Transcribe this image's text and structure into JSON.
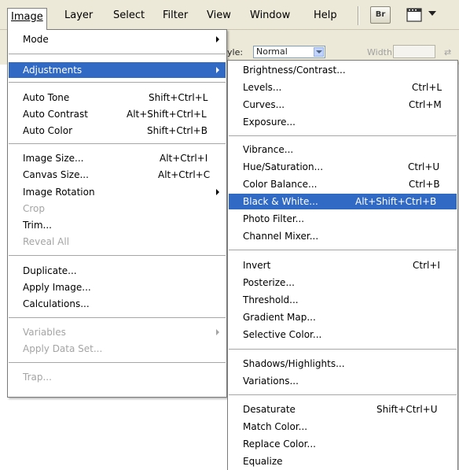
{
  "menubar": {
    "items": [
      {
        "label": "Image"
      },
      {
        "label": "Layer"
      },
      {
        "label": "Select"
      },
      {
        "label": "Filter"
      },
      {
        "label": "View"
      },
      {
        "label": "Window"
      },
      {
        "label": "Help"
      }
    ],
    "bridge_button": "Br",
    "screen_mode_icon": "screen-mode-icon"
  },
  "options_bar": {
    "style_label": "yle:",
    "style_value": "Normal",
    "width_label": "Width:"
  },
  "image_menu": {
    "items": [
      {
        "label": "Mode",
        "shortcut": "",
        "submenu": true
      },
      {
        "label": "Adjustments",
        "shortcut": "",
        "submenu": true
      },
      {
        "label": "Auto Tone",
        "shortcut": "Shift+Ctrl+L"
      },
      {
        "label": "Auto Contrast",
        "shortcut": "Alt+Shift+Ctrl+L"
      },
      {
        "label": "Auto Color",
        "shortcut": "Shift+Ctrl+B"
      },
      {
        "label": "Image Size...",
        "shortcut": "Alt+Ctrl+I"
      },
      {
        "label": "Canvas Size...",
        "shortcut": "Alt+Ctrl+C"
      },
      {
        "label": "Image Rotation",
        "shortcut": "",
        "submenu": true
      },
      {
        "label": "Crop",
        "shortcut": "",
        "disabled": true
      },
      {
        "label": "Trim...",
        "shortcut": ""
      },
      {
        "label": "Reveal All",
        "shortcut": "",
        "disabled": true
      },
      {
        "label": "Duplicate...",
        "shortcut": ""
      },
      {
        "label": "Apply Image...",
        "shortcut": ""
      },
      {
        "label": "Calculations...",
        "shortcut": ""
      },
      {
        "label": "Variables",
        "shortcut": "",
        "disabled": true,
        "submenu": true
      },
      {
        "label": "Apply Data Set...",
        "shortcut": "",
        "disabled": true
      },
      {
        "label": "Trap...",
        "shortcut": "",
        "disabled": true
      }
    ]
  },
  "adjustments_menu": {
    "items": [
      {
        "label": "Brightness/Contrast...",
        "shortcut": ""
      },
      {
        "label": "Levels...",
        "shortcut": "Ctrl+L"
      },
      {
        "label": "Curves...",
        "shortcut": "Ctrl+M"
      },
      {
        "label": "Exposure...",
        "shortcut": ""
      },
      {
        "label": "Vibrance...",
        "shortcut": ""
      },
      {
        "label": "Hue/Saturation...",
        "shortcut": "Ctrl+U"
      },
      {
        "label": "Color Balance...",
        "shortcut": "Ctrl+B"
      },
      {
        "label": "Black & White...",
        "shortcut": "Alt+Shift+Ctrl+B"
      },
      {
        "label": "Photo Filter...",
        "shortcut": ""
      },
      {
        "label": "Channel Mixer...",
        "shortcut": ""
      },
      {
        "label": "Invert",
        "shortcut": "Ctrl+I"
      },
      {
        "label": "Posterize...",
        "shortcut": ""
      },
      {
        "label": "Threshold...",
        "shortcut": ""
      },
      {
        "label": "Gradient Map...",
        "shortcut": ""
      },
      {
        "label": "Selective Color...",
        "shortcut": ""
      },
      {
        "label": "Shadows/Highlights...",
        "shortcut": ""
      },
      {
        "label": "Variations...",
        "shortcut": ""
      },
      {
        "label": "Desaturate",
        "shortcut": "Shift+Ctrl+U"
      },
      {
        "label": "Match Color...",
        "shortcut": ""
      },
      {
        "label": "Replace Color...",
        "shortcut": ""
      },
      {
        "label": "Equalize",
        "shortcut": ""
      }
    ]
  },
  "colors": {
    "highlight": "#316ac5",
    "menubar_bg": "#ece9d8",
    "disabled_text": "#a4a4a4"
  }
}
